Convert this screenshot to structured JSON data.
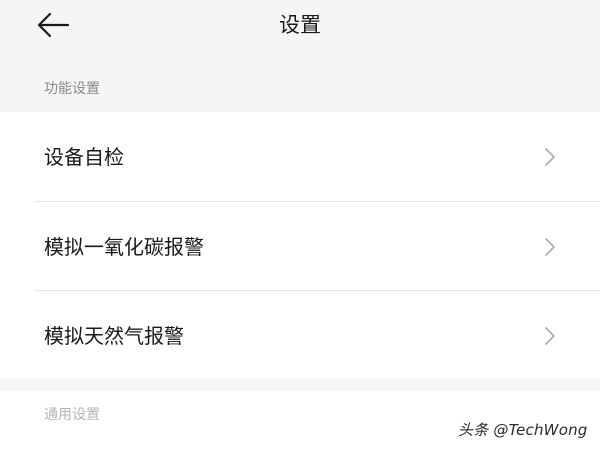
{
  "header": {
    "title": "设置",
    "back_icon": "arrow-left-icon"
  },
  "sections": [
    {
      "header": "功能设置",
      "items": [
        {
          "label": "设备自检",
          "icon": "chevron-right-icon"
        },
        {
          "label": "模拟一氧化碳报警",
          "icon": "chevron-right-icon"
        },
        {
          "label": "模拟天然气报警",
          "icon": "chevron-right-icon"
        }
      ]
    },
    {
      "header": "通用设置",
      "items": []
    }
  ],
  "watermark": "头条 @TechWong",
  "colors": {
    "background": "#f5f5f5",
    "card": "#ffffff",
    "text": "#1a1a1a",
    "section_text": "#8a8a8a",
    "chevron": "#b0b0b0",
    "divider": "#e4e4e4"
  }
}
